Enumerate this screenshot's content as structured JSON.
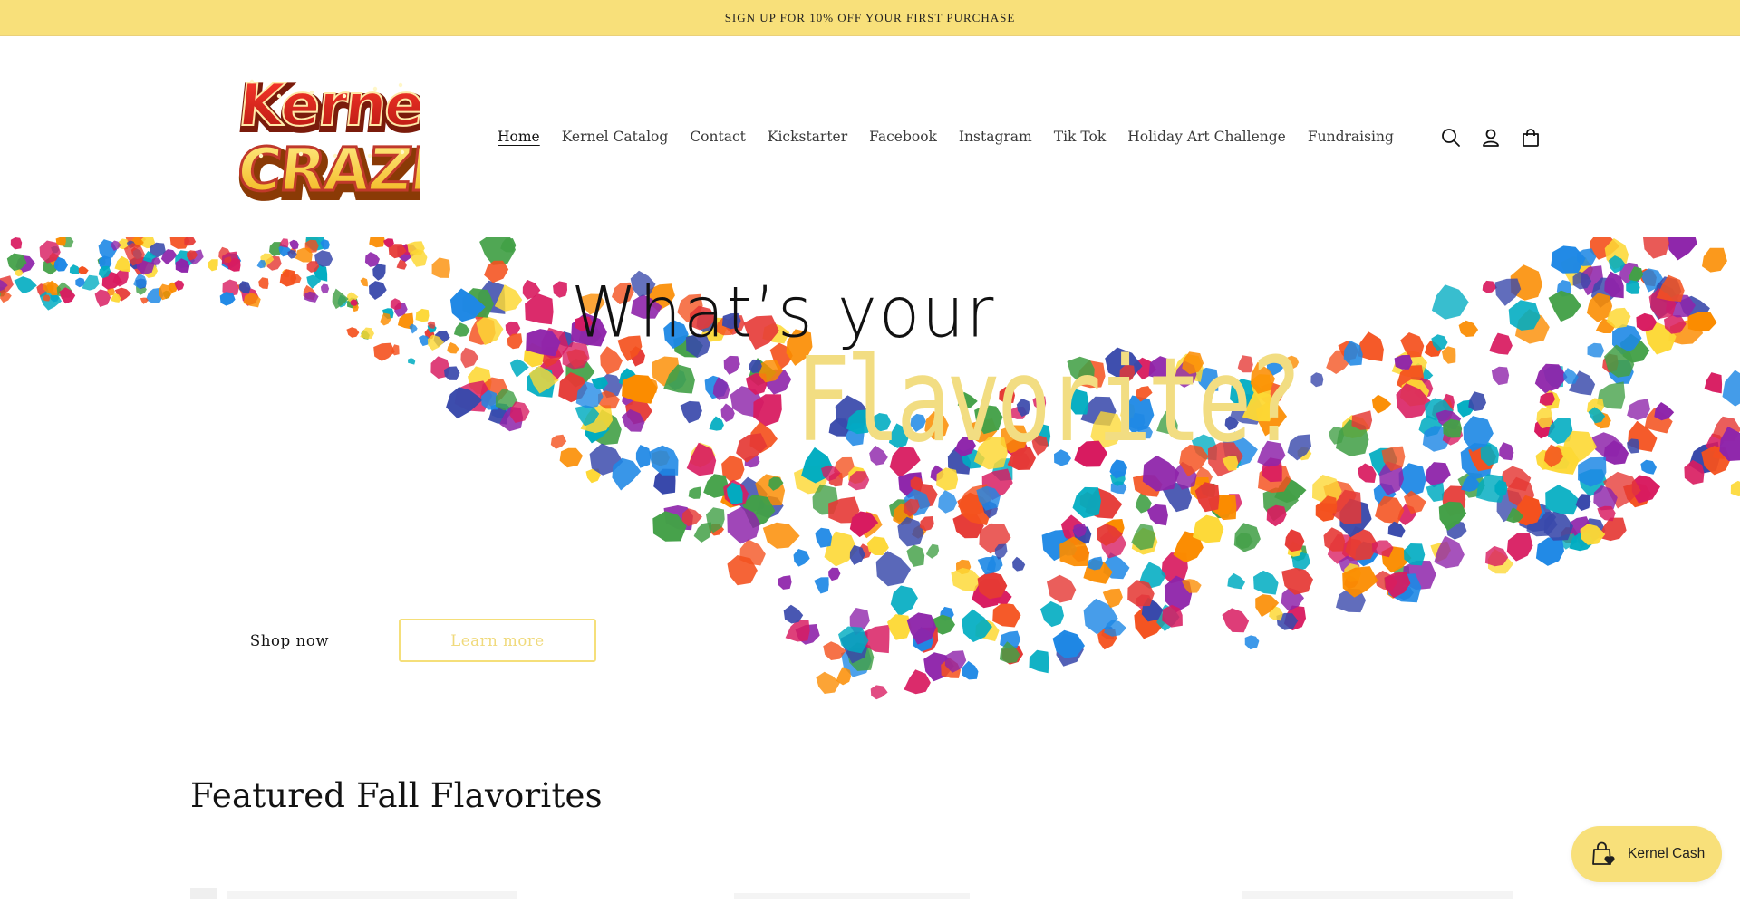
{
  "announcement": {
    "text": "SIGN UP FOR 10% OFF YOUR FIRST PURCHASE"
  },
  "logo": {
    "line1": "Kernel",
    "line2": "CRAZE"
  },
  "nav": {
    "items": [
      {
        "label": "Home",
        "active": true
      },
      {
        "label": "Kernel Catalog"
      },
      {
        "label": "Contact"
      },
      {
        "label": "Kickstarter"
      },
      {
        "label": "Facebook"
      },
      {
        "label": "Instagram"
      },
      {
        "label": "Tik Tok"
      },
      {
        "label": "Holiday Art Challenge"
      },
      {
        "label": "Fundraising"
      }
    ]
  },
  "header_icons": [
    "search-icon",
    "account-icon",
    "cart-icon"
  ],
  "hero": {
    "line1": "What’s your",
    "line2": "Flavorite?",
    "primary_button": "Shop now",
    "secondary_button": "Learn more"
  },
  "featured": {
    "title": "Featured Fall Flavorites"
  },
  "widget": {
    "label": "Kernel Cash"
  },
  "colors": {
    "accent": "#f8e07a",
    "logo_red": "#d6261f",
    "logo_yellow": "#f6c72d",
    "text": "#121212"
  }
}
